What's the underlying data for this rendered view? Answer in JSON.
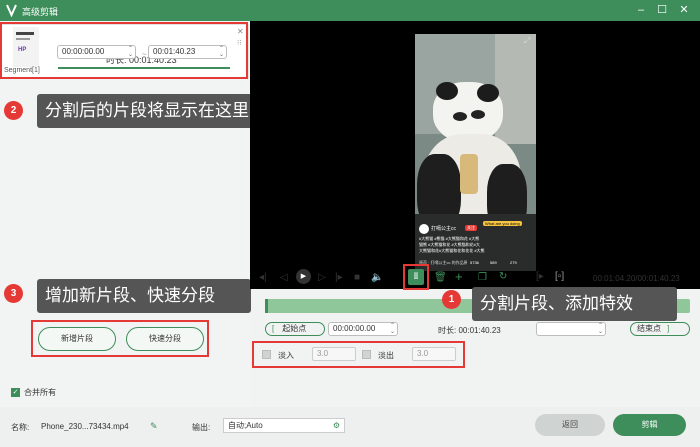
{
  "window": {
    "title": "高级剪辑"
  },
  "segment": {
    "label": "Segment[1]",
    "duration_label": "时长:",
    "duration_value": "00:01:40.23",
    "start_time": "00:00:00.00",
    "end_time": "00:01:40.23",
    "thumb_text": "HP"
  },
  "annotations": {
    "tip1": "分割片段、添加特效",
    "tip2": "分割后的片段将显示在这里",
    "tip3": "增加新片段、快速分段",
    "n1": "1",
    "n2": "2",
    "n3": "3"
  },
  "buttons": {
    "add_segment": "新增片段",
    "quick_split": "快速分段",
    "merge_all": "合并所有",
    "back": "返回",
    "edit": "剪辑"
  },
  "video": {
    "channel": "打嗝公主cc",
    "caption_line1": "#大熊猫 #熊猫 #大熊猫和花 #大熊",
    "caption_line2": "猫熊 #大熊猫和花 #大熊猫和花#大",
    "caption_line3": "大熊猫和花#大熊猫和花和花花 #大熊",
    "badge_text": "What are you doing",
    "follow": "关注",
    "likes": "5736",
    "comments": "589",
    "shares": "279",
    "audio": "原声 · 打嗝公主cc 的作品原声"
  },
  "playback": {
    "current_total": "00:01:04.20/00:01:40.23"
  },
  "trim": {
    "start_label": "起始点",
    "start_value": "00:00:00.00",
    "duration_label": "时长:",
    "duration_value": "00:01:40.23",
    "end_label": "结束点"
  },
  "fade": {
    "fade_in_label": "淡入",
    "fade_in_value": "3.0",
    "fade_out_label": "淡出",
    "fade_out_value": "3.0"
  },
  "footer": {
    "name_label": "名称:",
    "name_value": "Phone_230...73434.mp4",
    "output_label": "输出:",
    "output_value": "自动;Auto"
  },
  "colors": {
    "brand": "#3e8e5b",
    "annotation": "#e53935",
    "tip_bg": "#555555"
  },
  "icons": [
    "app-logo-icon",
    "minimize-icon",
    "maximize-icon",
    "close-icon",
    "prev-frame-icon",
    "play-icon",
    "next-frame-icon",
    "stop-icon",
    "volume-icon",
    "split-icon",
    "delete-icon",
    "add-icon",
    "copy-icon",
    "rotate-icon",
    "crop-icon",
    "fullscreen-icon",
    "rename-icon",
    "settings-icon"
  ]
}
